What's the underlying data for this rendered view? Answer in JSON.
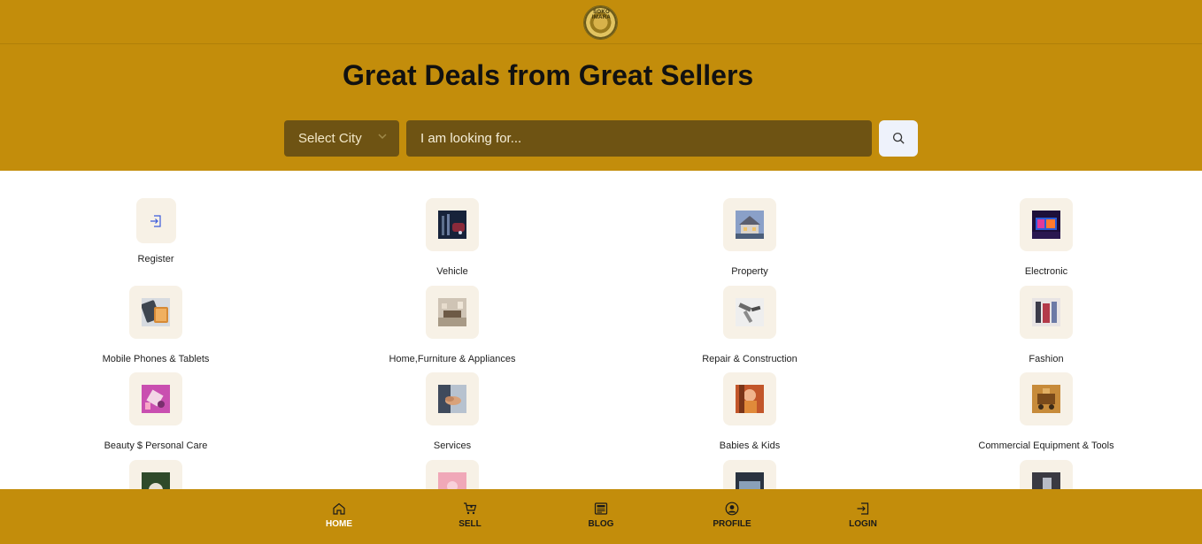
{
  "header": {
    "logo_text": "SOKO IMARA"
  },
  "hero": {
    "title": "Great Deals from Great Sellers",
    "city_select_value": "Select City",
    "search_placeholder": "I am looking for..."
  },
  "categories": [
    {
      "label": "Register",
      "icon": "login-icon"
    },
    {
      "label": "Vehicle",
      "icon": "vehicle-thumbnail"
    },
    {
      "label": "Property",
      "icon": "property-thumbnail"
    },
    {
      "label": "Electronic",
      "icon": "electronic-thumbnail"
    },
    {
      "label": "Mobile Phones & Tablets",
      "icon": "phones-thumbnail"
    },
    {
      "label": "Home,Furniture & Appliances",
      "icon": "furniture-thumbnail"
    },
    {
      "label": "Repair & Construction",
      "icon": "tools-thumbnail"
    },
    {
      "label": "Fashion",
      "icon": "fashion-thumbnail"
    },
    {
      "label": "Beauty $ Personal Care",
      "icon": "beauty-thumbnail"
    },
    {
      "label": "Services",
      "icon": "services-thumbnail"
    },
    {
      "label": "Babies & Kids",
      "icon": "babies-thumbnail"
    },
    {
      "label": "Commercial Equipment & Tools",
      "icon": "equipment-thumbnail"
    }
  ],
  "bottom_nav": {
    "home": "HOME",
    "sell": "SELL",
    "blog": "BLOG",
    "profile": "PROFILE",
    "login": "LOGIN",
    "active": "home"
  },
  "colors": {
    "brand": "#C38D0B",
    "input_bg": "#6E5313",
    "tile_bg": "#F7F1E6"
  }
}
